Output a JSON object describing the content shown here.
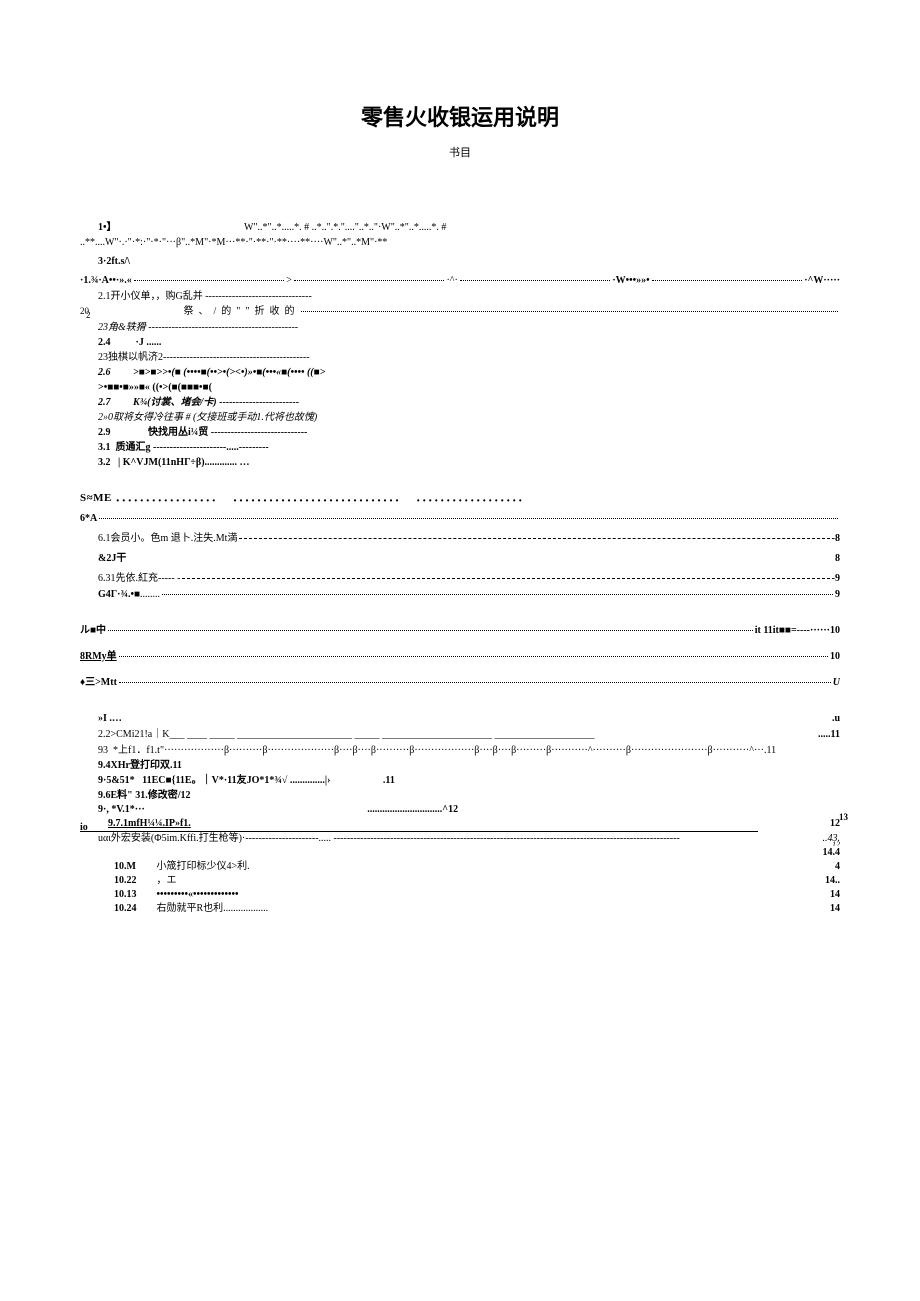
{
  "title": "零售火收银运用说明",
  "subtitle": "书目",
  "sec1": {
    "l1": "1•】",
    "l1r": "W\"..*\"..*.....*. # ..*..\".*.\"....\"..*..\"·W\"..*\"..*.....*. #",
    "l2": "..**....W\"·.·\"·*:·\"·*·\"···β\"..*M\"·*M···**·\"·**·\"·**····**····W\"..*\"..*M\"·**",
    "l3": "3·2ft.s/\\",
    "l4a": "·1.¾·A••·».«",
    "l4b": ">",
    "l4c": "·^·",
    "l4d": "·W•••»»•",
    "l4e": "·^W·····",
    "l5": "2.1开小仪单，，购G乱并 --------------------------------",
    "l6a": "20",
    "l6b": " 2",
    "l6c": "祭、/的\"\"折收的",
    "l7": "23角&轶猾 ---------------------------------------------",
    "l7b": "2.4          ·J ......",
    "l8": "23独棋以帆济2--------------------------------------------",
    "l9": "2.6         >■>■>>•(■ (••••■(••>•(><•)»•■(•••«■(•••• ((■>",
    "l9b": ">•■■•■»»■« ((•>(■(■■■•■(",
    "l10": "2.7         K¾(讨裳、堵会/卡) ------------------------",
    "l11": "2»0取将女得冷往事 # (攵接班或手动1.代将也故愧)",
    "l12": "2.9               快找用丛i¼贸 -----------------------------",
    "l13": "3.1  质通汇g ----------------------.....---------",
    "l14": "3.2   | K^VJM(11nHΓ÷β)............. …"
  },
  "sec2": {
    "l1": "S≈ME ．．．．．．．．．．．．．．．．．   ．．．．．．．．．．．．．．．．．．．．．．．．．．．．   ．．．．．．．．．．．．．．．．．．",
    "l2": "6*A",
    "l3": "6.1会员小。色m     退卜.注失.Mt満",
    "l3p": "-8",
    "l4": "&2J干",
    "l4p": "8",
    "l5": "6.31先依.紅充----- -",
    "l5p": "-9",
    "l6": "G4Γ·¾.•■",
    "l6p": "9"
  },
  "sec3": {
    "l1": "ル■中",
    "l1p": "it 11it■■=----······10",
    "l2": "8RMy单",
    "l2p": "10",
    "l3": "♦三>Mtt",
    "l3p": "U"
  },
  "sec4": {
    "l1": "»I                     .…",
    "l1p": ".u",
    "l2": "2.2>CMi21!a｜K___  ____ _____  _______________________ _____ ______________________ ____________________",
    "l2p": ".....11",
    "l3": "93  *上f1．f1.t\"··················β··········β····················β····β····β··········β··················β····β····β·········β···········^··········β·······················β···········^···.11",
    "l4": "9.4XHr登打印双.11",
    "l5": "9·5&51*   11EC■{11E。｜V*·11友JO*1*¾√ ..............|›                     .11",
    "l6": "9.6E料\" 31.修改密/12",
    "l7a": "9·,  *V.1*···",
    "l7b": "..............................^12",
    "l8": "   9.7.1mfH¼¼.IP»f1.",
    "l8p": "12",
    "l9a": "io",
    "l9b": "13",
    "l10a": "uαι外宏安装(Φ5im.Kffi.打生枪等)·----------------------..... --------------------------------------------------------------------------------------------------------",
    "l10p": "..43.",
    "l10p2": "12",
    "l11p": "14.4",
    "r1a": "10.M",
    "r1b": "小筬打印标少仪4>利.",
    "r1p": "4",
    "r2a": "10.22",
    "r2b": "，エ",
    "r2p": "14..",
    "r3a": "10.13",
    "r3b": "•••••••••«•••••••••••••",
    "r3p": "14",
    "r4a": "10.24",
    "r4b": "右勋就平R也利..................",
    "r4p": "14"
  }
}
